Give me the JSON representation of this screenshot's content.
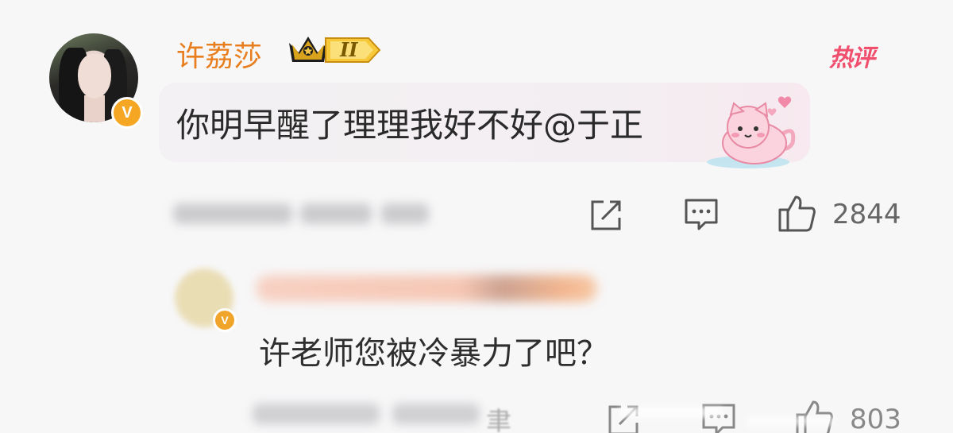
{
  "comment": {
    "username": "许荔莎",
    "level": "II",
    "hot_tag": "热评",
    "text": "你明早醒了理理我好不好@于正",
    "verified_mark": "V",
    "actions": {
      "share_icon": "share-icon",
      "comment_icon": "comment-icon",
      "like_icon": "thumbs-up-icon",
      "like_count": "2844"
    }
  },
  "reply": {
    "verified_mark": "V",
    "text": "许老师您被冷暴力了吧？",
    "meta_partial_char": "聿",
    "actions": {
      "like_count": "803"
    }
  },
  "colors": {
    "username": "#e87e1e",
    "hot_tag": "#f0506e",
    "verified": "#f5a623",
    "background": "#f7f7f8"
  }
}
